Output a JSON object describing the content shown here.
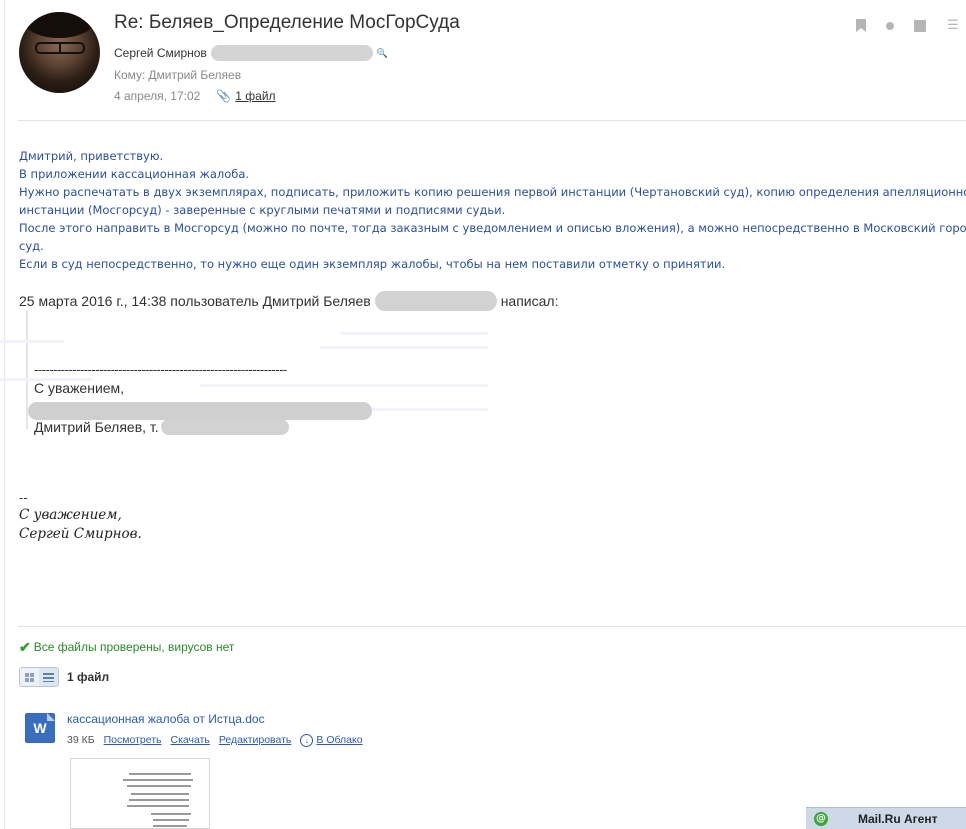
{
  "header": {
    "subject": "Re: Беляев_Определение МосГорСуда",
    "sender_name": "Сергей Смирнов",
    "to_label": "Кому:",
    "to_name": "Дмитрий Беляев",
    "date": "4 апреля, 17:02",
    "attachments_link": "1 файл"
  },
  "body": {
    "lines": [
      "Дмитрий, приветствую.",
      "В приложении кассационная жалоба.",
      "Нужно распечатать в двух экземплярах, подписать, приложить копию решения первой инстанции (Чертановский суд), копию определения апелляционной",
      "инстанции (Мосгорсуд) - заверенные с круглыми печатями и подписями судьи.",
      "После этого направить в Мосгорсуд (можно по почте, тогда заказным с уведомлением и описью вложения), а можно непосредственно в Московский городской",
      "суд.",
      "Если в суд непосредственно, то нужно еще один экземпляр жалобы, чтобы на нем поставили отметку о принятии."
    ]
  },
  "quote": {
    "header_prefix": "25 марта 2016 г., 14:38 пользователь Дмитрий Беляев",
    "header_suffix": "написал:",
    "dashes": "------------------------------------------------------------------",
    "regards": "С уважением,",
    "sign_prefix": "Дмитрий Беляев, т."
  },
  "signature": {
    "dash": "--",
    "line1": "С уважением,",
    "line2": "Сергей Смирнов."
  },
  "attachments": {
    "virus_status": "Все файлы проверены, вирусов нет",
    "count_label": "1 файл",
    "file_type_letter": "W",
    "file_name": "кассационная жалоба от Истца.doc",
    "file_size": "39 КБ",
    "actions": {
      "view": "Посмотреть",
      "download": "Скачать",
      "edit": "Редактировать",
      "cloud": "В Облако"
    }
  },
  "agent": {
    "label": "Mail.Ru Агент"
  },
  "colors": {
    "body_text": "#2a4fa0",
    "link": "#2a5ab8",
    "virus_ok": "#2a8a2a"
  }
}
